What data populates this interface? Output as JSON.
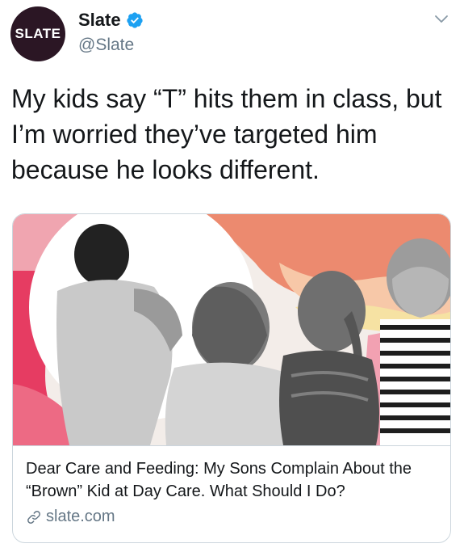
{
  "account": {
    "avatar_text": "SLATE",
    "display_name": "Slate",
    "handle": "@Slate",
    "verified_icon": "verified-badge-icon",
    "brand_color": "#2b1624",
    "verified_color": "#1da1f2"
  },
  "tweet": {
    "text": "My kids say “T” hits them in class, but I’m worried they’ve targeted him because he looks different."
  },
  "card": {
    "image_icon": "children-photo",
    "title": "Dear Care and Feeding: My Sons Complain About the “Brown” Kid at Day Care. What Should I Do?",
    "domain": "slate.com",
    "link_icon": "link-icon"
  },
  "menu": {
    "icon": "chevron-down-icon"
  }
}
